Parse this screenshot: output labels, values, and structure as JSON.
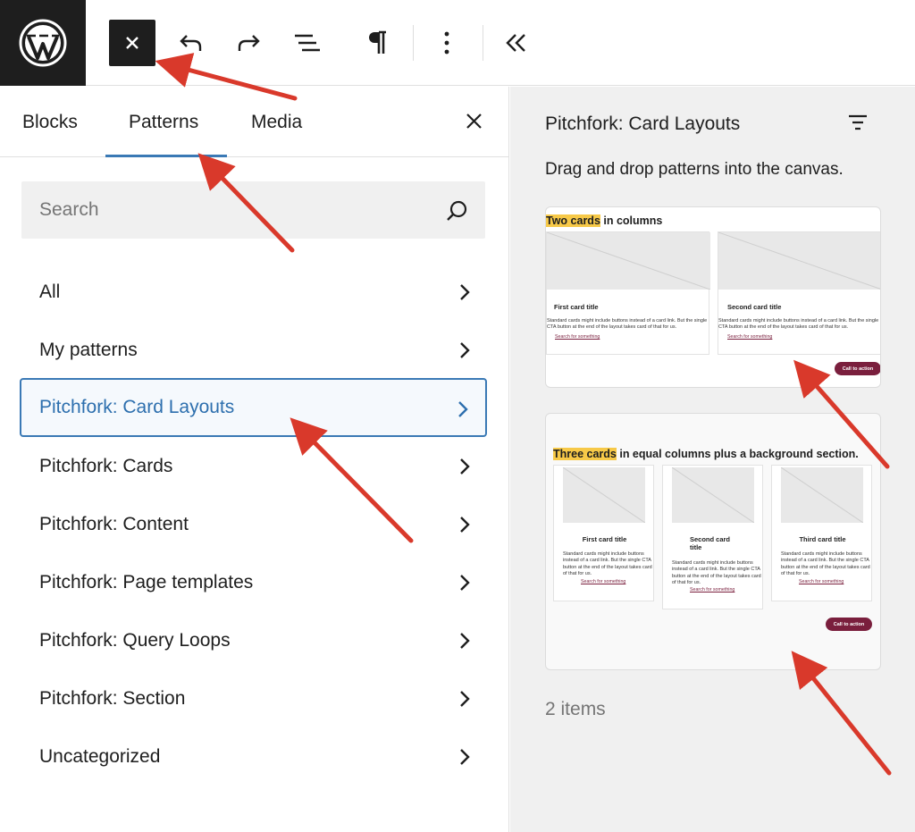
{
  "toolbar": {
    "logo_icon": "wordpress-logo",
    "close_icon": "close-icon",
    "undo_icon": "undo-icon",
    "redo_icon": "redo-icon",
    "list_view_icon": "list-view-icon",
    "paragraph_icon": "paragraph-icon",
    "more_icon": "more-vertical-icon",
    "collapse_icon": "chevron-double-left-icon"
  },
  "inserter": {
    "tabs": [
      {
        "label": "Blocks"
      },
      {
        "label": "Patterns"
      },
      {
        "label": "Media"
      }
    ],
    "active_tab": "Patterns",
    "search_placeholder": "Search",
    "categories": [
      {
        "label": "All"
      },
      {
        "label": "My patterns"
      },
      {
        "label": "Pitchfork: Card Layouts"
      },
      {
        "label": "Pitchfork: Cards"
      },
      {
        "label": "Pitchfork: Content"
      },
      {
        "label": "Pitchfork: Page templates"
      },
      {
        "label": "Pitchfork: Query Loops"
      },
      {
        "label": "Pitchfork: Section"
      },
      {
        "label": "Uncategorized"
      }
    ],
    "active_category": "Pitchfork: Card Layouts"
  },
  "patterns_panel": {
    "title": "Pitchfork: Card Layouts",
    "description": "Drag and drop patterns into the canvas.",
    "count": "2 items",
    "pattern1": {
      "heading_highlight": "Two cards",
      "heading_rest": " in columns",
      "card1_title": "First card title",
      "card2_title": "Second card title",
      "body": "Standard cards might include buttons instead of a card link. But the single CTA button at the end of the layout takes card of that for us.",
      "link": "Search for something",
      "cta": "Call to action"
    },
    "pattern2": {
      "heading_highlight": "Three cards",
      "heading_rest": " in equal columns plus a background section.",
      "card1_title": "First card title",
      "card2_title": "Second card title",
      "card3_title": "Third card title",
      "body": "Standard cards might include buttons instead of a card link. But the single CTA button at the end of the layout takes card of that for us.",
      "link": "Search for something",
      "cta": "Call to action"
    }
  },
  "colors": {
    "accent": "#3a79b5",
    "highlight": "#f7c948",
    "cta": "#7a1f3d",
    "annotation_arrow": "#d9392b"
  }
}
